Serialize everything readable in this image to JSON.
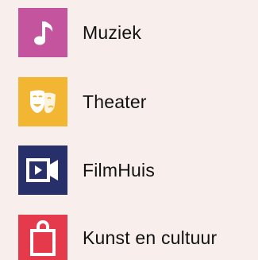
{
  "menu": {
    "items": [
      {
        "label": "Muziek",
        "icon": "music-note-icon",
        "color": "#c3549d"
      },
      {
        "label": "Theater",
        "icon": "theater-mask-icon",
        "color": "#f2b632"
      },
      {
        "label": "FilmHuis",
        "icon": "video-camera-icon",
        "color": "#27306b"
      },
      {
        "label": "Kunst en cultuur",
        "icon": "shopping-bag-icon",
        "color": "#e53a4c"
      }
    ]
  }
}
